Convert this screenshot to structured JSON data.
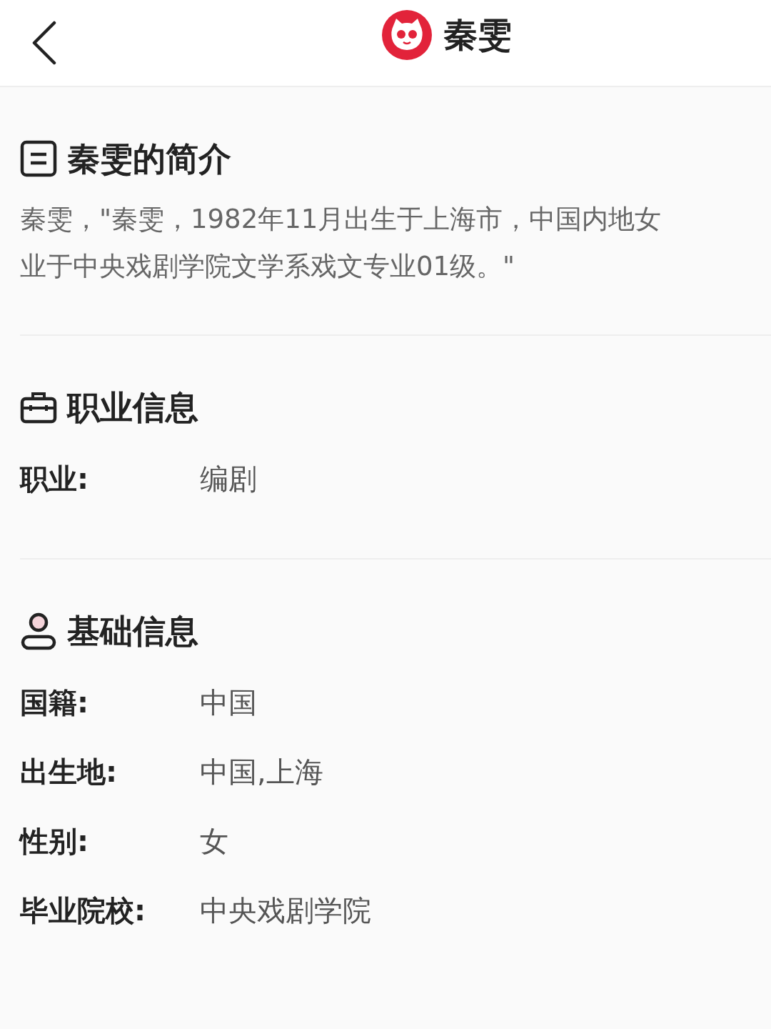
{
  "header": {
    "title": "秦雯"
  },
  "sections": [
    {
      "kind": "text",
      "title": "秦雯的简介",
      "lines": [
        "秦雯，\"秦雯，1982年11月出生于上海市，中国内地女",
        "业于中央戏剧学院文学系戏文专业01级。\""
      ]
    },
    {
      "kind": "fields",
      "title": "职业信息",
      "rows": [
        {
          "label": "职业:",
          "value": "编剧"
        }
      ]
    },
    {
      "kind": "fields",
      "title": "基础信息",
      "rows": [
        {
          "label": "国籍:",
          "value": "中国"
        },
        {
          "label": "出生地:",
          "value": "中国,上海"
        },
        {
          "label": "性别:",
          "value": "女"
        },
        {
          "label": "毕业院校:",
          "value": "中央戏剧学院"
        }
      ]
    }
  ]
}
